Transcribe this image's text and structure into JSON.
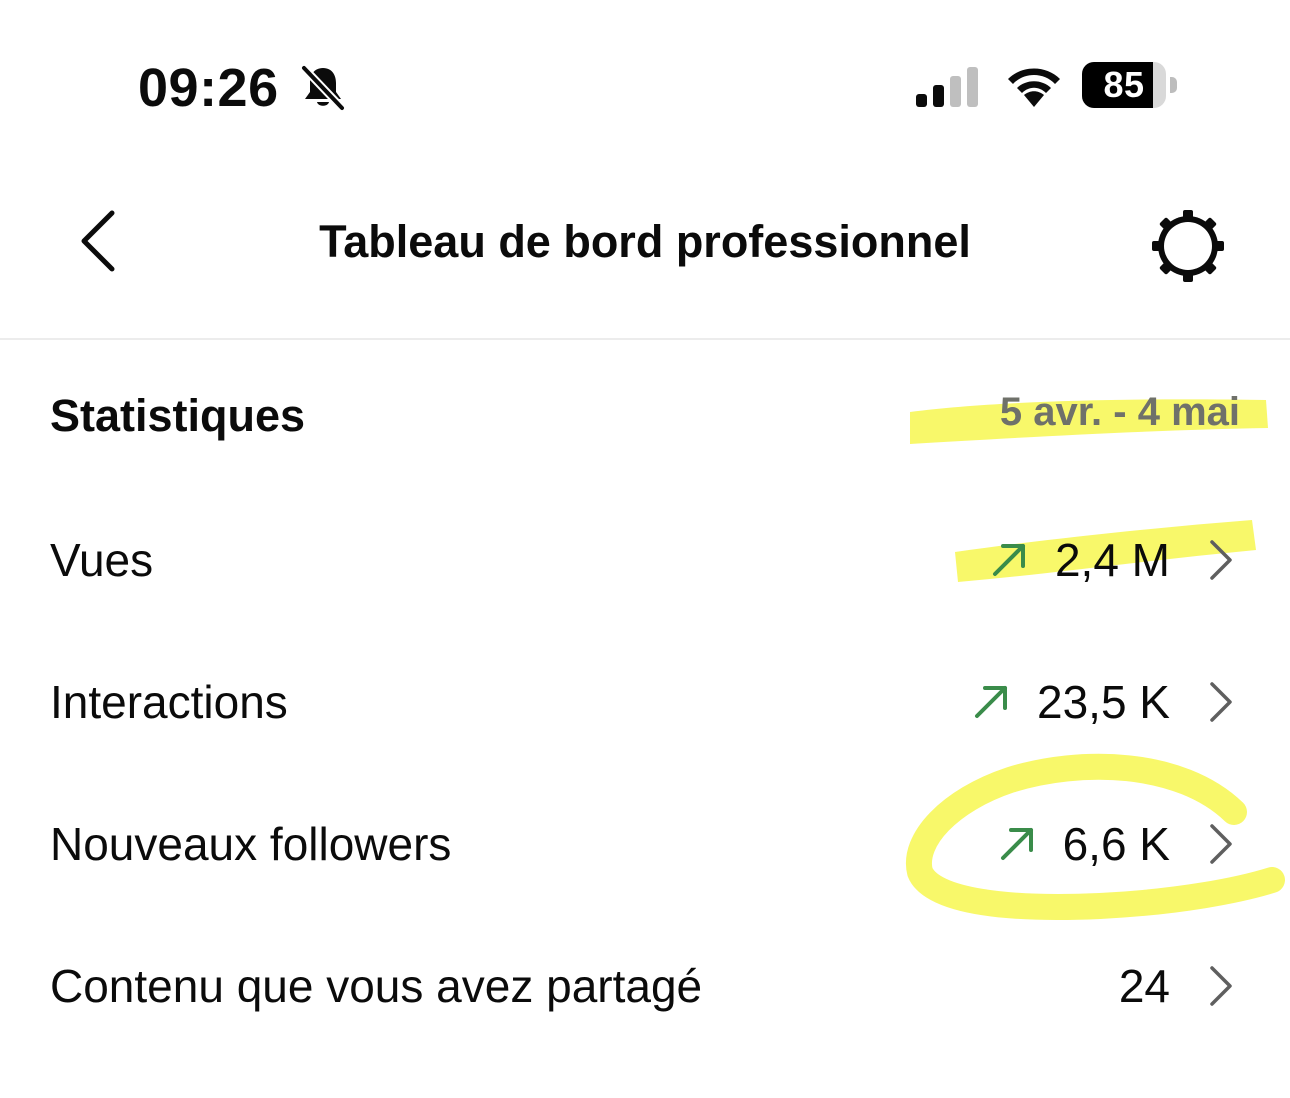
{
  "status_bar": {
    "time": "09:26",
    "battery_level": "85",
    "battery_fraction": 0.85,
    "icons": [
      "bell-slash-icon",
      "signal-icon",
      "wifi-icon",
      "battery-icon"
    ]
  },
  "header": {
    "title": "Tableau de bord professionnel",
    "back_icon": "chevron-left-icon",
    "settings_icon": "settings-gear-icon"
  },
  "statistics": {
    "title": "Statistiques",
    "date_range": "5 avr. - 4 mai",
    "rows": [
      {
        "label": "Vues",
        "value": "2,4 M",
        "trend": "up"
      },
      {
        "label": "Interactions",
        "value": "23,5 K",
        "trend": "up"
      },
      {
        "label": "Nouveaux followers",
        "value": "6,6 K",
        "trend": "up"
      },
      {
        "label": "Contenu que vous avez partagé",
        "value": "24",
        "trend": "none"
      }
    ]
  },
  "colors": {
    "trend_up": "#3a8c4a",
    "highlighter": "#f7f75a",
    "secondary_text": "#6f716a",
    "chevron": "#5f5f5f"
  }
}
